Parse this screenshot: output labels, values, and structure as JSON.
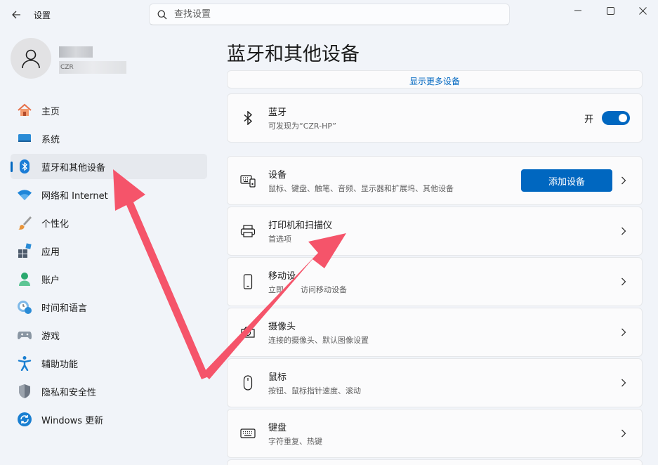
{
  "app": {
    "title": "设置"
  },
  "search": {
    "placeholder": "查找设置"
  },
  "user": {
    "email_fragment": "CZR"
  },
  "nav": {
    "items": [
      {
        "label": "主页",
        "icon": "home-icon"
      },
      {
        "label": "系统",
        "icon": "system-icon"
      },
      {
        "label": "蓝牙和其他设备",
        "icon": "bluetooth-icon",
        "active": true
      },
      {
        "label": "网络和 Internet",
        "icon": "wifi-icon"
      },
      {
        "label": "个性化",
        "icon": "brush-icon"
      },
      {
        "label": "应用",
        "icon": "apps-icon"
      },
      {
        "label": "账户",
        "icon": "account-icon"
      },
      {
        "label": "时间和语言",
        "icon": "clock-globe-icon"
      },
      {
        "label": "游戏",
        "icon": "gamepad-icon"
      },
      {
        "label": "辅助功能",
        "icon": "accessibility-icon"
      },
      {
        "label": "隐私和安全性",
        "icon": "shield-icon"
      },
      {
        "label": "Windows 更新",
        "icon": "update-icon"
      }
    ]
  },
  "page": {
    "title": "蓝牙和其他设备",
    "show_more": "显示更多设备",
    "bluetooth": {
      "title": "蓝牙",
      "subtitle": "可发现为“CZR-HP”",
      "toggle_label": "开",
      "on": true
    },
    "devices": {
      "title": "设备",
      "subtitle": "鼠标、键盘、触笔、音频、显示器和扩展坞、其他设备",
      "add_button": "添加设备"
    },
    "rows": [
      {
        "title": "打印机和扫描仪",
        "subtitle": "首选项",
        "icon": "printer-icon"
      },
      {
        "title": "移动设",
        "subtitle": "立即",
        "subtitle2": "访问移动设备",
        "icon": "phone-icon"
      },
      {
        "title": "摄像头",
        "subtitle": "连接的摄像头、默认图像设置",
        "icon": "camera-icon"
      },
      {
        "title": "鼠标",
        "subtitle": "按钮、鼠标指针速度、滚动",
        "icon": "mouse-icon"
      },
      {
        "title": "键盘",
        "subtitle": "字符重复、热键",
        "icon": "keyboard-icon"
      }
    ]
  },
  "colors": {
    "accent": "#0067c0",
    "annotation_arrow": "#f5546a"
  }
}
